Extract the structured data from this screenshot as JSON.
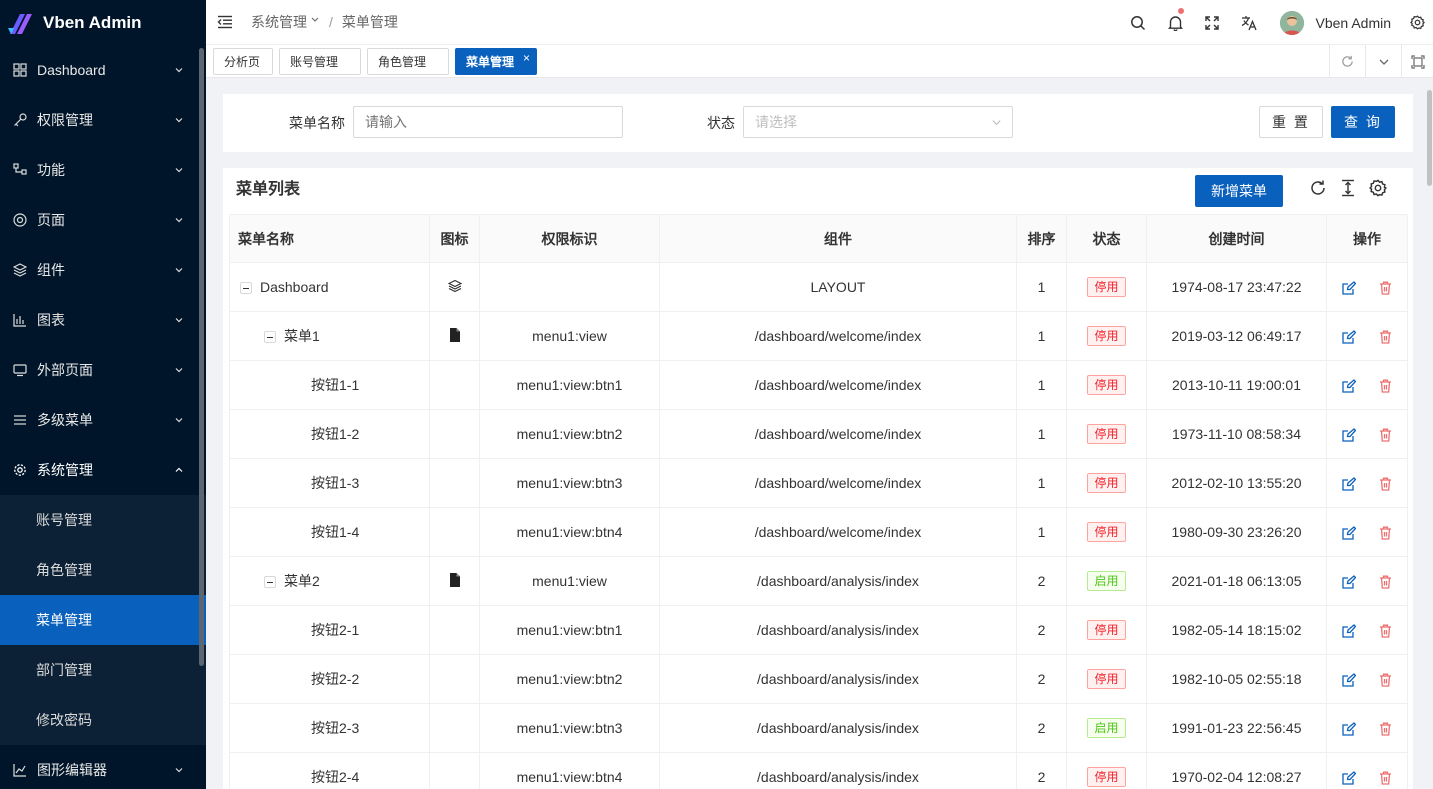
{
  "app": {
    "title": "Vben Admin",
    "colors": {
      "primary": "#0960bd",
      "sidebar": "#001529",
      "danger": "#ed6f6f"
    }
  },
  "sidebar": {
    "items": [
      {
        "label": "Dashboard",
        "icon": "dashboard-grid-icon"
      },
      {
        "label": "权限管理",
        "icon": "key-icon"
      },
      {
        "label": "功能",
        "icon": "function-icon"
      },
      {
        "label": "页面",
        "icon": "page-icon"
      },
      {
        "label": "组件",
        "icon": "layers-icon"
      },
      {
        "label": "图表",
        "icon": "chart-icon"
      },
      {
        "label": "外部页面",
        "icon": "monitor-icon"
      },
      {
        "label": "多级菜单",
        "icon": "menu-icon"
      },
      {
        "label": "系统管理",
        "icon": "gear-icon"
      }
    ],
    "system_sub": [
      "账号管理",
      "角色管理",
      "菜单管理",
      "部门管理",
      "修改密码"
    ],
    "last_item": {
      "label": "图形编辑器",
      "icon": "graph-icon"
    }
  },
  "header": {
    "breadcrumb": [
      "系统管理",
      "菜单管理"
    ],
    "user_name": "Vben Admin"
  },
  "tabs": [
    "分析页",
    "账号管理",
    "角色管理",
    "菜单管理"
  ],
  "search": {
    "name_label": "菜单名称",
    "name_placeholder": "请输入",
    "status_label": "状态",
    "status_placeholder": "请选择",
    "reset": "重 置",
    "query": "查 询"
  },
  "table": {
    "title": "菜单列表",
    "add_button": "新增菜单",
    "columns": [
      "菜单名称",
      "图标",
      "权限标识",
      "组件",
      "排序",
      "状态",
      "创建时间",
      "操作"
    ],
    "rows": [
      {
        "name": "Dashboard",
        "perm": "",
        "component": "LAYOUT",
        "order": "1",
        "status": "停用",
        "created": "1974-08-17 23:47:22"
      },
      {
        "name": "菜单1",
        "perm": "menu1:view",
        "component": "/dashboard/welcome/index",
        "order": "1",
        "status": "停用",
        "created": "2019-03-12 06:49:17"
      },
      {
        "name": "按钮1-1",
        "perm": "menu1:view:btn1",
        "component": "/dashboard/welcome/index",
        "order": "1",
        "status": "停用",
        "created": "2013-10-11 19:00:01"
      },
      {
        "name": "按钮1-2",
        "perm": "menu1:view:btn2",
        "component": "/dashboard/welcome/index",
        "order": "1",
        "status": "停用",
        "created": "1973-11-10 08:58:34"
      },
      {
        "name": "按钮1-3",
        "perm": "menu1:view:btn3",
        "component": "/dashboard/welcome/index",
        "order": "1",
        "status": "停用",
        "created": "2012-02-10 13:55:20"
      },
      {
        "name": "按钮1-4",
        "perm": "menu1:view:btn4",
        "component": "/dashboard/welcome/index",
        "order": "1",
        "status": "停用",
        "created": "1980-09-30 23:26:20"
      },
      {
        "name": "菜单2",
        "perm": "menu1:view",
        "component": "/dashboard/analysis/index",
        "order": "2",
        "status": "启用",
        "created": "2021-01-18 06:13:05"
      },
      {
        "name": "按钮2-1",
        "perm": "menu1:view:btn1",
        "component": "/dashboard/analysis/index",
        "order": "2",
        "status": "停用",
        "created": "1982-05-14 18:15:02"
      },
      {
        "name": "按钮2-2",
        "perm": "menu1:view:btn2",
        "component": "/dashboard/analysis/index",
        "order": "2",
        "status": "停用",
        "created": "1982-10-05 02:55:18"
      },
      {
        "name": "按钮2-3",
        "perm": "menu1:view:btn3",
        "component": "/dashboard/analysis/index",
        "order": "2",
        "status": "启用",
        "created": "1991-01-23 22:56:45"
      },
      {
        "name": "按钮2-4",
        "perm": "menu1:view:btn4",
        "component": "/dashboard/analysis/index",
        "order": "2",
        "status": "停用",
        "created": "1970-02-04 12:08:27"
      }
    ]
  }
}
